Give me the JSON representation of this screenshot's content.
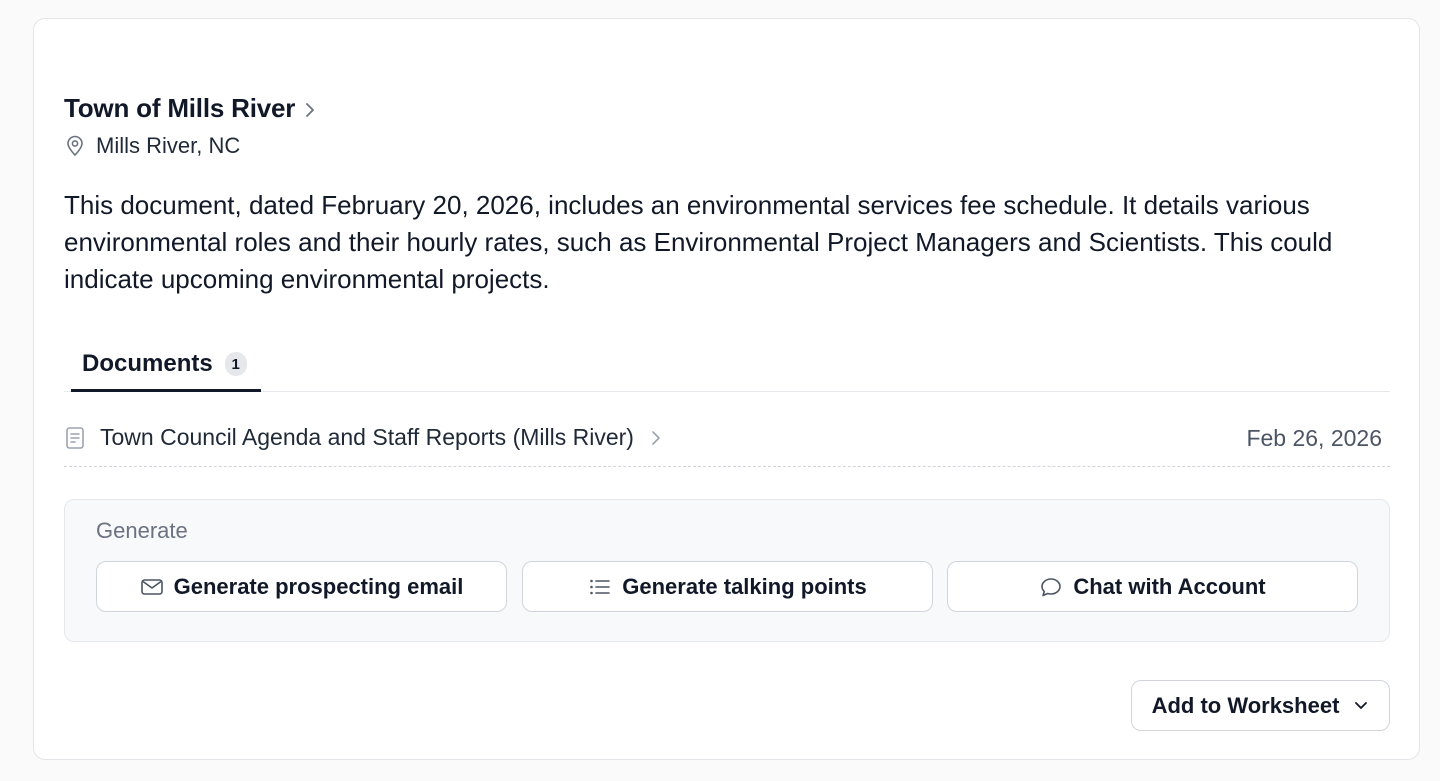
{
  "account": {
    "name": "Town of Mills River",
    "name_icon": "chevron-right-icon",
    "location": "Mills River, NC",
    "location_icon": "map-pin-icon"
  },
  "summary": "This document, dated February 20, 2026, includes an environmental services fee schedule. It details various environmental roles and their hourly rates, such as Environmental Project Managers and Scientists. This could indicate upcoming environmental projects.",
  "tabs": [
    {
      "label": "Documents",
      "count": "1",
      "active": true
    }
  ],
  "documents": [
    {
      "title": "Town Council Agenda and Staff Reports (Mills River)",
      "date": "Feb 26, 2026",
      "icon": "document-icon"
    }
  ],
  "generate": {
    "heading": "Generate",
    "buttons": [
      {
        "label": "Generate prospecting email",
        "icon": "mail-icon"
      },
      {
        "label": "Generate talking points",
        "icon": "list-icon"
      },
      {
        "label": "Chat with Account",
        "icon": "chat-bubble-icon"
      }
    ]
  },
  "actions": {
    "add_to_worksheet": "Add to Worksheet",
    "add_to_worksheet_icon": "chevron-down-icon"
  },
  "colors": {
    "text_primary": "#111827",
    "text_muted": "#6b7280",
    "border": "#d1d5db",
    "panel_bg": "#f7f9fb"
  }
}
